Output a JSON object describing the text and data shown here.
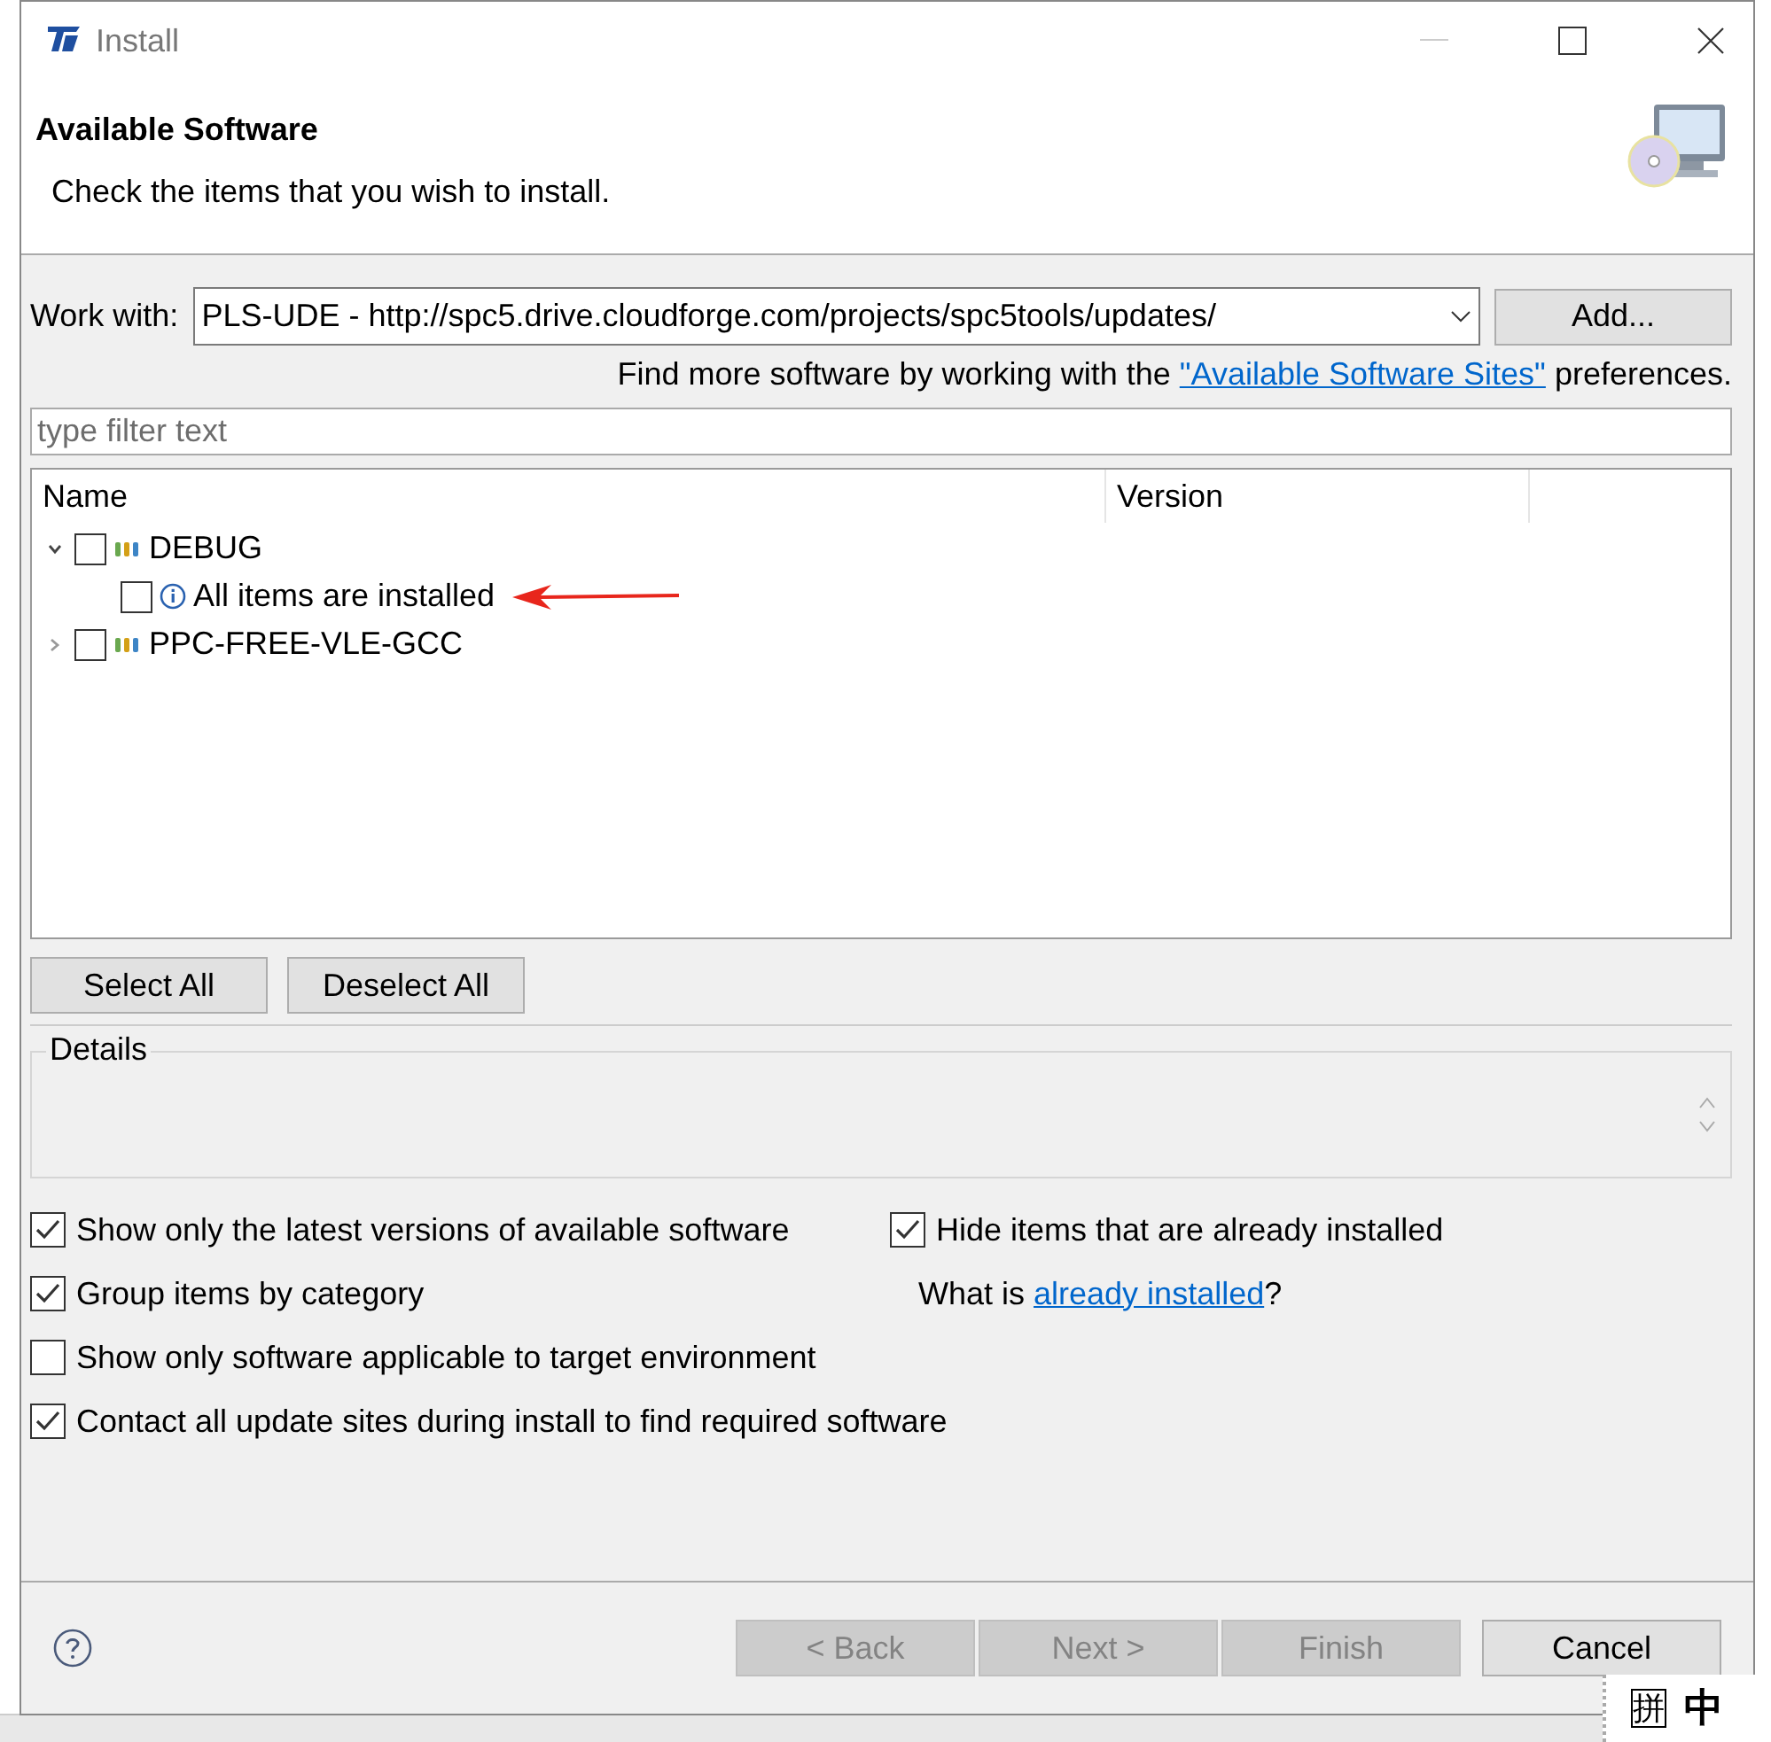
{
  "window": {
    "title": "Install"
  },
  "header": {
    "title": "Available Software",
    "description": "Check the items that you wish to install."
  },
  "work_with": {
    "label": "Work with:",
    "value": "PLS-UDE - http://spc5.drive.cloudforge.com/projects/spc5tools/updates/",
    "add_button": "Add..."
  },
  "more_software": {
    "before": "Find more software by working with the ",
    "link": "\"Available Software Sites\"",
    "after": " preferences."
  },
  "filter": {
    "placeholder": "type filter text"
  },
  "tree": {
    "columns": [
      "Name",
      "Version"
    ],
    "items": [
      {
        "label": "DEBUG",
        "kind": "category",
        "checked": false,
        "expanded": true,
        "children": [
          {
            "label": "All items are installed",
            "kind": "info",
            "checked": false
          }
        ]
      },
      {
        "label": "PPC-FREE-VLE-GCC",
        "kind": "category",
        "checked": false,
        "expanded": false
      }
    ]
  },
  "selection_buttons": [
    "Select All",
    "Deselect All"
  ],
  "details": {
    "label": "Details"
  },
  "left_options": [
    {
      "label": "Show only the latest versions of available software",
      "checked": true
    },
    {
      "label": "Group items by category",
      "checked": true
    },
    {
      "label": "Show only software applicable to target environment",
      "checked": false
    },
    {
      "label": "Contact all update sites during install to find required software",
      "checked": true
    }
  ],
  "right_options": [
    {
      "label": "Hide items that are already installed",
      "checked": true
    }
  ],
  "what_is": {
    "before": "What is ",
    "link": "already installed",
    "after": "?"
  },
  "footer_buttons": [
    {
      "label": "< Back",
      "disabled": true
    },
    {
      "label": "Next >",
      "disabled": true
    },
    {
      "label": "Finish",
      "disabled": true
    },
    {
      "label": "Cancel",
      "disabled": false
    }
  ],
  "ime": [
    "拼",
    "中"
  ]
}
